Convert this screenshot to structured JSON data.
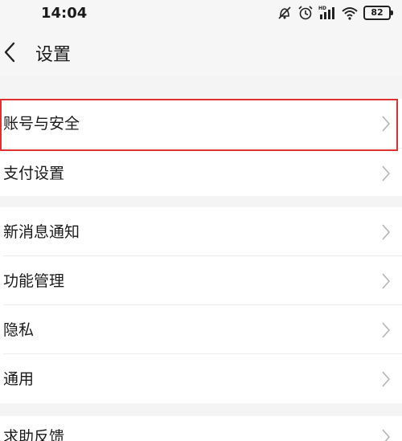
{
  "status_bar": {
    "time": "14:04",
    "icons": [
      "mute-alarm-icon",
      "alarm-icon",
      "signal-icon",
      "wifi-icon",
      "battery-icon"
    ],
    "network_label": "HD",
    "battery_level": "82"
  },
  "header": {
    "back_icon": "chevron-left-icon",
    "title": "设置"
  },
  "groups": [
    {
      "items": [
        {
          "label": "账号与安全"
        },
        {
          "label": "支付设置"
        }
      ]
    },
    {
      "items": [
        {
          "label": "新消息通知"
        },
        {
          "label": "功能管理"
        },
        {
          "label": "隐私"
        },
        {
          "label": "通用"
        }
      ]
    },
    {
      "items": [
        {
          "label": "求助反馈"
        }
      ]
    }
  ],
  "colors": {
    "highlight_border": "#e03030",
    "background": "#f4f4f4",
    "row_background": "#ffffff"
  }
}
